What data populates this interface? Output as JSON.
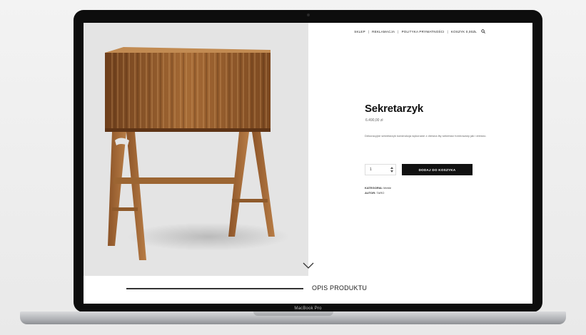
{
  "device": {
    "brand_label": "MacBook Pro"
  },
  "nav": {
    "items": [
      {
        "label": "Sklep",
        "icon": ""
      },
      {
        "label": "Reklamacja",
        "icon": ""
      },
      {
        "label": "Polityka prywatności",
        "icon": ""
      },
      {
        "label": "Koszyk 0,00zł",
        "icon": ""
      }
    ],
    "search_icon": "search-icon"
  },
  "product": {
    "title": "Sekretarzyk",
    "price": "6.490,00 zł",
    "description": "Dekoracyjne sekretarzyk konstrukcja wykonane z drewna lity sekretarz fornirowany jak i drewno.",
    "quantity": "1",
    "add_to_cart_label": "Dodaj do koszyka",
    "category_label": "KATEGORIA:",
    "category_value": "Meble",
    "author_label": "AUTOR:",
    "author_value": "TARO"
  },
  "section": {
    "title": "OPIS PRODUKTU"
  },
  "colors": {
    "button_bg": "#111111",
    "image_bg": "#e4e4e4",
    "wood_dark": "#7a4a22",
    "wood_light": "#b47c45"
  }
}
